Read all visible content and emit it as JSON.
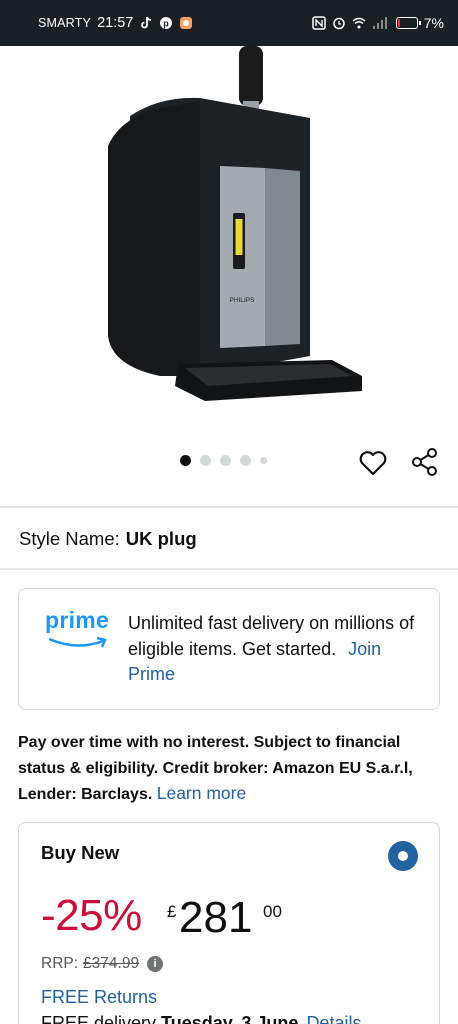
{
  "status_bar": {
    "carrier": "SMARTY",
    "time": "21:57",
    "battery": "7%",
    "icons": [
      "tiktok-icon",
      "pinterest-icon",
      "app-notification-icon",
      "nfc-icon",
      "alarm-icon",
      "wifi-icon",
      "signal-icon",
      "battery-icon"
    ]
  },
  "product": {
    "image_icon": "beer-tap-machine-image",
    "brand_on_device": "PHILIPS",
    "carousel": {
      "total": 5,
      "active_index": 0
    }
  },
  "actions": {
    "wishlist_icon": "heart-icon",
    "share_icon": "share-icon"
  },
  "style": {
    "label": "Style Name:",
    "value": "UK plug"
  },
  "prime": {
    "logo_text": "prime",
    "message": "Unlimited fast delivery on millions of eligible items. Get started.",
    "join_label": "Join Prime"
  },
  "finance": {
    "text": "Pay over time with no interest. Subject to financial status & eligibility. Credit broker: Amazon EU S.a.r.l, Lender: Barclays.",
    "learn_more": "Learn more"
  },
  "buy_box": {
    "title": "Buy New",
    "discount": "-25%",
    "currency": "£",
    "price_whole": "281",
    "price_fraction": "00",
    "rrp_label": "RRP:",
    "rrp_value": "£374.99",
    "free_returns": "FREE Returns",
    "delivery_prefix": "FREE delivery",
    "delivery_date": "Tuesday, 3 June",
    "details_label": "Details"
  },
  "colors": {
    "status_bar_bg": "#1a1f26",
    "link": "#2162a1",
    "discount": "#cc0c39",
    "prime": "#1a98ff"
  }
}
